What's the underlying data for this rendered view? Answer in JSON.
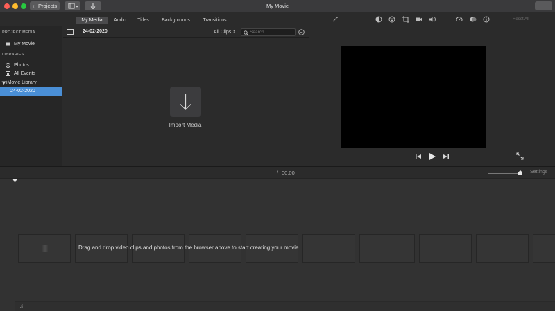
{
  "window": {
    "title": "My Movie"
  },
  "toolbar": {
    "projects_label": "Projects",
    "share_label": ""
  },
  "tabs": [
    {
      "label": "My Media",
      "active": true
    },
    {
      "label": "Audio",
      "active": false
    },
    {
      "label": "Titles",
      "active": false
    },
    {
      "label": "Backgrounds",
      "active": false
    },
    {
      "label": "Transitions",
      "active": false
    }
  ],
  "sidebar": {
    "project_media_heading": "PROJECT MEDIA",
    "libraries_heading": "LIBRARIES",
    "items": [
      {
        "label": "My Movie",
        "icon": "film-icon"
      },
      {
        "label": "Photos",
        "icon": "photos-icon"
      },
      {
        "label": "All Events",
        "icon": "events-icon"
      },
      {
        "label": "iMovie Library",
        "icon": "disclosure-triangle-icon"
      },
      {
        "label": "24-02-2020",
        "icon": ""
      }
    ]
  },
  "browser": {
    "event_title": "24-02-2020",
    "filter_value": "All Clips",
    "search_placeholder": "Search",
    "import_label": "Import Media"
  },
  "viewer": {
    "reset_all_label": "Reset All",
    "adjust_icons": [
      "magic-wand-icon",
      "color-balance-icon",
      "color-correction-icon",
      "crop-icon",
      "stabilization-icon",
      "volume-icon",
      "speed-icon",
      "noise-reduction-icon",
      "clip-info-icon"
    ]
  },
  "timeline": {
    "timecode_separator": "/",
    "timecode": "00:00",
    "settings_label": "Settings",
    "placeholder_text": "Drag and drop video clips and photos from the browser above to start creating your movie."
  },
  "colors": {
    "selection": "#4a8fd6",
    "background": "#2b2b2b",
    "viewer_screen": "#000000"
  }
}
